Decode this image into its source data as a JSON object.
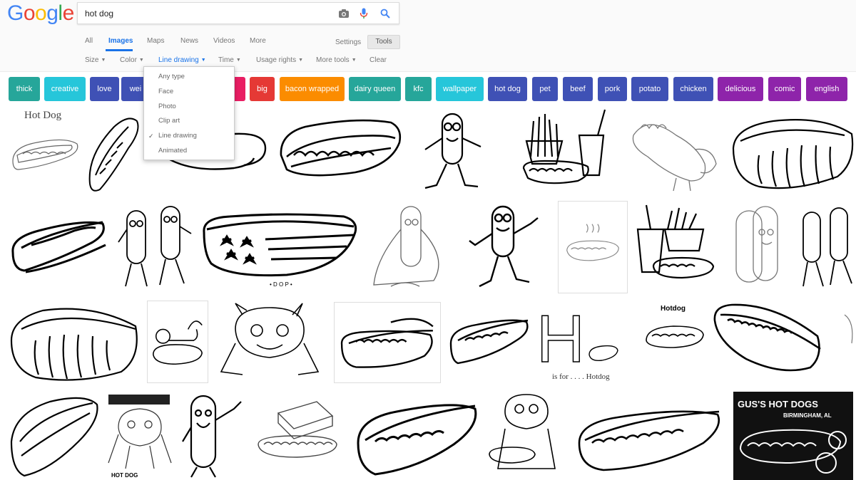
{
  "logo": {
    "letters": [
      "G",
      "o",
      "o",
      "g",
      "l",
      "e"
    ],
    "colors": [
      "#4285F4",
      "#EA4335",
      "#FBBC05",
      "#4285F4",
      "#34A853",
      "#EA4335"
    ]
  },
  "search": {
    "query": "hot dog"
  },
  "icons": {
    "camera": "camera-icon",
    "mic": "microphone-icon",
    "search": "search-icon"
  },
  "nav": {
    "tabs": [
      {
        "label": "All",
        "active": false
      },
      {
        "label": "Images",
        "active": true
      },
      {
        "label": "Maps",
        "active": false
      },
      {
        "label": "News",
        "active": false
      },
      {
        "label": "Videos",
        "active": false
      },
      {
        "label": "More",
        "active": false
      }
    ],
    "settings_label": "Settings",
    "tools_label": "Tools"
  },
  "tools": {
    "items": [
      {
        "label": "Size",
        "active": false
      },
      {
        "label": "Color",
        "active": false
      },
      {
        "label": "Line drawing",
        "active": true
      },
      {
        "label": "Time",
        "active": false
      },
      {
        "label": "Usage rights",
        "active": false
      },
      {
        "label": "More tools",
        "active": false
      }
    ],
    "clear_label": "Clear"
  },
  "dropdown": {
    "items": [
      {
        "label": "Any type",
        "checked": false
      },
      {
        "label": "Face",
        "checked": false
      },
      {
        "label": "Photo",
        "checked": false
      },
      {
        "label": "Clip art",
        "checked": false
      },
      {
        "label": "Line drawing",
        "checked": true
      },
      {
        "label": "Animated",
        "checked": false
      }
    ],
    "check_glyph": "✓"
  },
  "chips": [
    {
      "label": "thick",
      "color": "#26a69a"
    },
    {
      "label": "creative",
      "color": "#26c6da"
    },
    {
      "label": "love",
      "color": "#3f51b5"
    },
    {
      "label": "wei",
      "color": "#3f51b5"
    },
    {
      "label": "",
      "color": "#e91e63"
    },
    {
      "label": "big",
      "color": "#e53935"
    },
    {
      "label": "bacon wrapped",
      "color": "#fb8c00"
    },
    {
      "label": "dairy queen",
      "color": "#26a69a"
    },
    {
      "label": "kfc",
      "color": "#26a69a"
    },
    {
      "label": "wallpaper",
      "color": "#26c6da"
    },
    {
      "label": "hot dog",
      "color": "#3f51b5"
    },
    {
      "label": "pet",
      "color": "#3f51b5"
    },
    {
      "label": "beef",
      "color": "#3f51b5"
    },
    {
      "label": "pork",
      "color": "#3f51b5"
    },
    {
      "label": "potato",
      "color": "#3f51b5"
    },
    {
      "label": "chicken",
      "color": "#3f51b5"
    },
    {
      "label": "delicious",
      "color": "#8e24aa"
    },
    {
      "label": "comic",
      "color": "#8e24aa"
    },
    {
      "label": "english",
      "color": "#8e24aa"
    }
  ],
  "results": {
    "captions": {
      "hot_dog_title": "Hot Dog",
      "hotdog_heading": "Hotdog",
      "big_letter": "H",
      "is_for": "is for . . . . Hotdog",
      "hot_dog_bottom": "HOT DOG",
      "gus_sign": "GUS'S HOT DOGS",
      "birmingham": "BIRMINGHAM, AL",
      "flag_dots": "• D O P •"
    }
  }
}
